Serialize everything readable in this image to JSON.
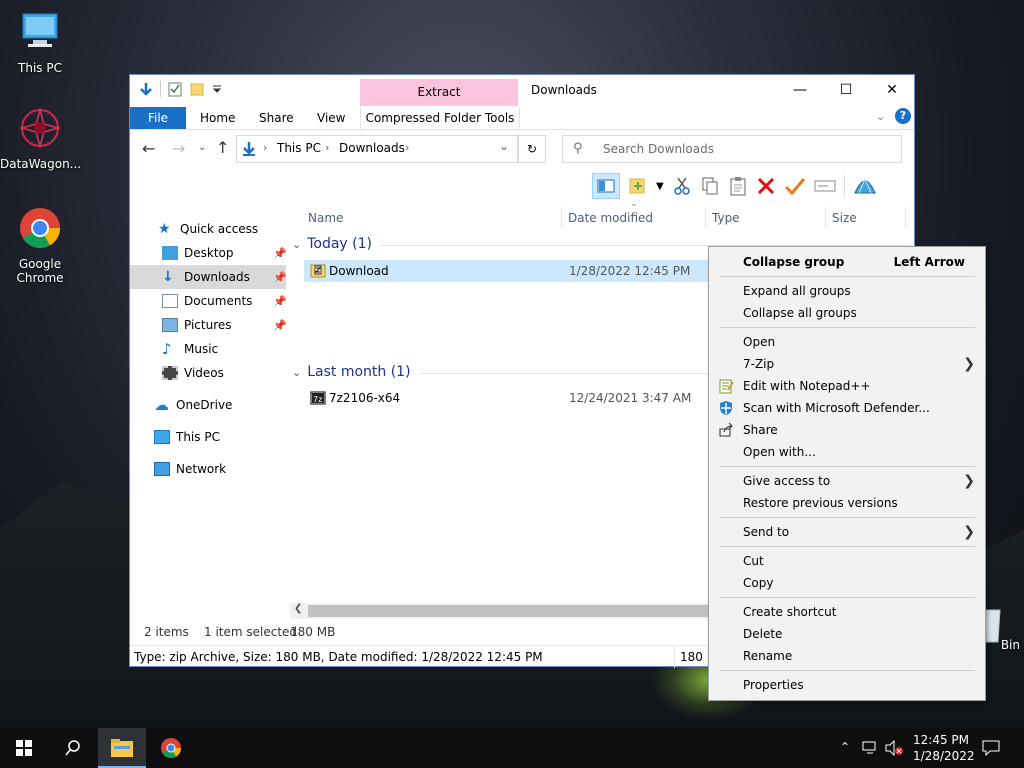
{
  "desktop": {
    "icons": [
      {
        "label": "This PC"
      },
      {
        "label": "DataWagon..."
      },
      {
        "label": "Google Chrome"
      },
      {
        "label": "Bin"
      }
    ]
  },
  "explorer": {
    "title": "Downloads",
    "context_tab_header": "Extract",
    "ribbon_tabs": [
      "File",
      "Home",
      "Share",
      "View",
      "Compressed Folder Tools"
    ],
    "address": {
      "crumbs": [
        "This PC",
        "Downloads"
      ]
    },
    "search_placeholder": "Search Downloads",
    "nav": [
      {
        "label": "Quick access"
      },
      {
        "label": "Desktop"
      },
      {
        "label": "Downloads"
      },
      {
        "label": "Documents"
      },
      {
        "label": "Pictures"
      },
      {
        "label": "Music"
      },
      {
        "label": "Videos"
      },
      {
        "label": "OneDrive"
      },
      {
        "label": "This PC"
      },
      {
        "label": "Network"
      }
    ],
    "columns": [
      "Name",
      "Date modified",
      "Type",
      "Size"
    ],
    "groups": [
      {
        "label": "Today (1)",
        "files": [
          {
            "name": "Download",
            "date": "1/28/2022 12:45 PM"
          }
        ]
      },
      {
        "label": "Last month (1)",
        "files": [
          {
            "name": "7z2106-x64",
            "date": "12/24/2021 3:47 AM"
          }
        ]
      }
    ],
    "status": {
      "items": "2 items",
      "selected": "1 item selected",
      "size": "180 MB"
    },
    "info": {
      "text": "Type: zip Archive, Size: 180 MB, Date modified: 1/28/2022 12:45 PM",
      "size": "180 M"
    }
  },
  "context_menu": {
    "items": [
      {
        "label": "Collapse group",
        "shortcut": "Left Arrow"
      },
      {
        "label": "Expand all groups"
      },
      {
        "label": "Collapse all groups"
      },
      {
        "label": "Open"
      },
      {
        "label": "7-Zip"
      },
      {
        "label": "Edit with Notepad++"
      },
      {
        "label": "Scan with Microsoft Defender..."
      },
      {
        "label": "Share"
      },
      {
        "label": "Open with..."
      },
      {
        "label": "Give access to"
      },
      {
        "label": "Restore previous versions"
      },
      {
        "label": "Send to"
      },
      {
        "label": "Cut"
      },
      {
        "label": "Copy"
      },
      {
        "label": "Create shortcut"
      },
      {
        "label": "Delete"
      },
      {
        "label": "Rename"
      },
      {
        "label": "Properties"
      }
    ]
  },
  "taskbar": {
    "time": "12:45 PM",
    "date": "1/28/2022"
  },
  "colors": {
    "accent": "#1a6fc7",
    "selection": "#cce8ff",
    "context_tab": "#fbc4de",
    "group_text": "#1e3287"
  }
}
